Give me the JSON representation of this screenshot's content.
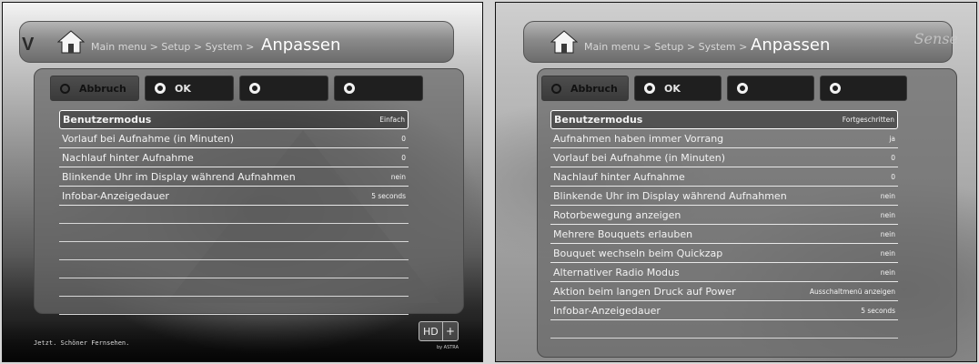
{
  "left": {
    "logo_text": "V",
    "breadcrumb": "Main menu > Setup > System >",
    "title": "Anpassen",
    "buttons": [
      {
        "label": "Abbruch"
      },
      {
        "label": "OK"
      },
      {
        "label": ""
      },
      {
        "label": ""
      }
    ],
    "rows": [
      {
        "label": "Benutzermodus",
        "value": "Einfach",
        "selected": true
      },
      {
        "label": "Vorlauf bei Aufnahme (in Minuten)",
        "value": "0"
      },
      {
        "label": "Nachlauf hinter Aufnahme",
        "value": "0"
      },
      {
        "label": "Blinkende Uhr im Display während Aufnahmen",
        "value": "nein"
      },
      {
        "label": "Infobar-Anzeigedauer",
        "value": "5 seconds"
      }
    ],
    "slogan": "Jetzt. Schöner Fernsehen.",
    "hd_badge": "HD",
    "hd_plus": "+",
    "brand_small": "by ASTRA"
  },
  "right": {
    "breadcrumb": "Main menu > Setup > System >",
    "title": "Anpassen",
    "corner_logo": "Sense",
    "buttons": [
      {
        "label": "Abbruch"
      },
      {
        "label": "OK"
      },
      {
        "label": ""
      },
      {
        "label": ""
      }
    ],
    "rows": [
      {
        "label": "Benutzermodus",
        "value": "Fortgeschritten",
        "selected": true
      },
      {
        "label": "Aufnahmen haben immer Vorrang",
        "value": "ja"
      },
      {
        "label": "Vorlauf bei Aufnahme (in Minuten)",
        "value": "0"
      },
      {
        "label": "Nachlauf hinter Aufnahme",
        "value": "0"
      },
      {
        "label": "Blinkende Uhr im Display während Aufnahmen",
        "value": "nein"
      },
      {
        "label": "Rotorbewegung anzeigen",
        "value": "nein"
      },
      {
        "label": "Mehrere Bouquets erlauben",
        "value": "nein"
      },
      {
        "label": "Bouquet wechseln beim Quickzap",
        "value": "nein"
      },
      {
        "label": "Alternativer Radio Modus",
        "value": "nein"
      },
      {
        "label": "Aktion beim langen Druck auf Power",
        "value": "Ausschaltmenü anzeigen"
      },
      {
        "label": "Infobar-Anzeigedauer",
        "value": "5 seconds"
      }
    ]
  }
}
